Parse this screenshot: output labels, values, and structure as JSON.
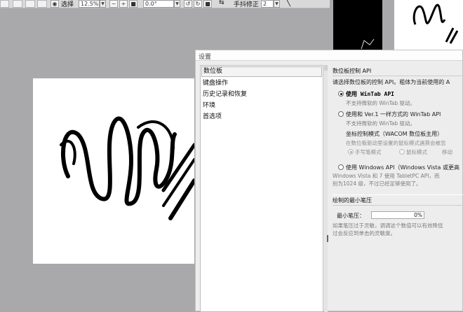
{
  "toolbar": {
    "select_label": "选择",
    "zoom_value": "12.5%",
    "rotation_value": "0.0°",
    "stabilizer_label": "手抖修正",
    "stabilizer_value": "2"
  },
  "dialog": {
    "title": "设置",
    "categories": [
      {
        "label": "数位板",
        "selected": true
      },
      {
        "label": "键盘操作"
      },
      {
        "label": "历史记录和恢复"
      },
      {
        "label": "环境"
      },
      {
        "label": "首选项"
      }
    ],
    "tablet": {
      "section_title": "数位板控制 API",
      "description": "请选择数位板的控制 API。粗体为当前使用的 A",
      "option_wintab": "使用 WinTab API",
      "option_wintab_note": "不支持微软的 WinTab 驱动。",
      "option_ver1": "使用和 Ver.1 一样方式的 WinTab API",
      "option_ver1_note": "不支持微软的 WinTab 驱动。",
      "coord_mode_label": "坐标控制模式（WACOM 数位板主用）",
      "coord_mode_note": "在数位板驱动里设置的鼠标模式遇莫会被忽",
      "mode_pen": "手写笔模式",
      "mode_mouse": "鼠标模式",
      "mode_move": "移动",
      "option_windows": "使用 Windows API（Windows Vista 或更高",
      "option_windows_note1": "Windows Vista 和 7 使用 TabletPC API，而",
      "option_windows_note2": "别为1024 级，不过已经足够使用了。"
    },
    "pressure": {
      "section_title": "绘制的最小笔压",
      "min_label": "最小笔压：",
      "min_value": "0%",
      "note1": "如果笔压过于灵敏，调调这个数值可以有效降低",
      "note2": "过会反应到单击的灵敏度。"
    }
  }
}
